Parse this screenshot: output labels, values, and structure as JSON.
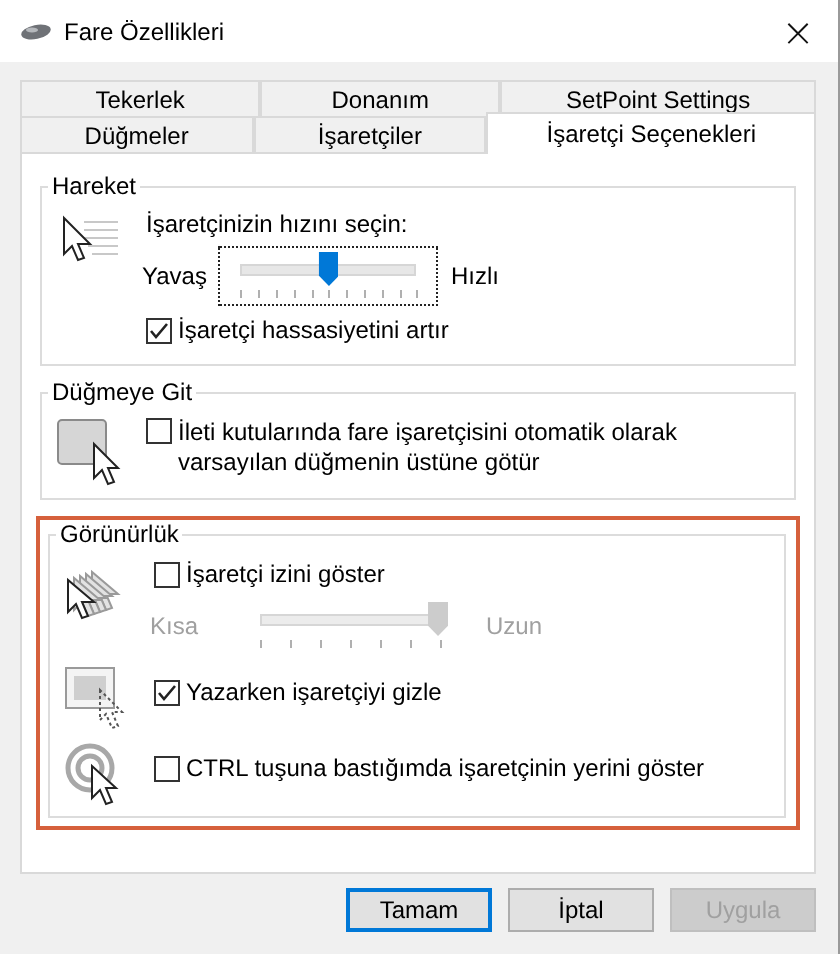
{
  "window": {
    "title": "Fare Özellikleri",
    "close": "×"
  },
  "tab_rows": [
    [
      {
        "label": "Tekerlek",
        "selected": false
      },
      {
        "label": "Donanım",
        "selected": false
      },
      {
        "label": "SetPoint Settings",
        "selected": false
      }
    ],
    [
      {
        "label": "Düğmeler",
        "selected": false
      },
      {
        "label": "İşaretçiler",
        "selected": false
      },
      {
        "label": "İşaretçi Seçenekleri",
        "selected": true
      }
    ]
  ],
  "motion": {
    "title": "Hareket",
    "prompt": "İşaretçinizin hızını seçin:",
    "speed": {
      "min_label": "Yavaş",
      "max_label": "Hızlı",
      "level": 0.5,
      "focused": true,
      "disabled": false
    },
    "precision": {
      "label": "İşaretçi hassasiyetini artır",
      "checked": true
    }
  },
  "snap_to": {
    "title": "Düğmeye Git",
    "option": {
      "label": "İleti kutularında fare işaretçisini otomatik olarak varsayılan düğmenin üstüne götür",
      "checked": false
    }
  },
  "visibility": {
    "title": "Görünürlük",
    "highlighted": true,
    "trails": {
      "label": "İşaretçi izini göster",
      "checked": false
    },
    "trail_length": {
      "min_label": "Kısa",
      "max_label": "Uzun",
      "level": 1,
      "focused": false,
      "disabled": true
    },
    "hide_typing": {
      "label": "Yazarken işaretçiyi gizle",
      "checked": true
    },
    "ctrl_locate": {
      "label": "CTRL tuşuna bastığımda işaretçinin yerini göster",
      "checked": false
    }
  },
  "buttons": [
    {
      "label": "Tamam",
      "default": true,
      "disabled": false
    },
    {
      "label": "İptal",
      "default": false,
      "disabled": false
    },
    {
      "label": "Uygula",
      "default": false,
      "disabled": true
    }
  ]
}
